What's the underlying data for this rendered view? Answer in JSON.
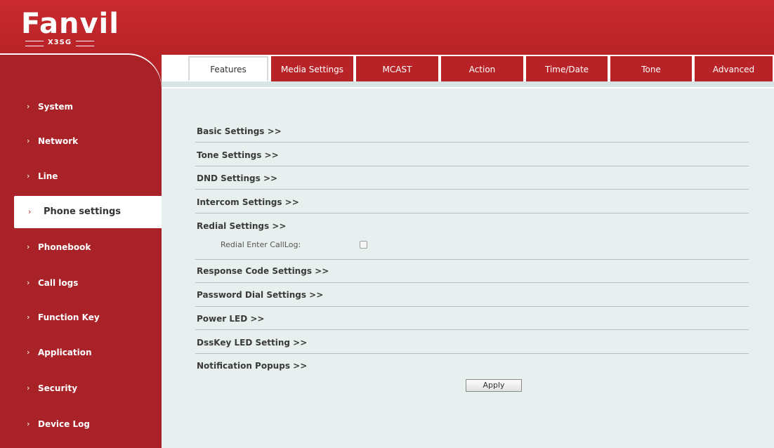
{
  "brand": {
    "logo_text": "Fanvil",
    "model": "X3SG"
  },
  "tabs": [
    {
      "label": "Features",
      "active": true
    },
    {
      "label": "Media Settings",
      "active": false
    },
    {
      "label": "MCAST",
      "active": false
    },
    {
      "label": "Action",
      "active": false
    },
    {
      "label": "Time/Date",
      "active": false
    },
    {
      "label": "Tone",
      "active": false
    },
    {
      "label": "Advanced",
      "active": false
    }
  ],
  "sidebar": {
    "items": [
      {
        "label": "System"
      },
      {
        "label": "Network"
      },
      {
        "label": "Line"
      },
      {
        "label": "Phone settings",
        "active": true
      },
      {
        "label": "Phonebook"
      },
      {
        "label": "Call logs"
      },
      {
        "label": "Function Key"
      },
      {
        "label": "Application"
      },
      {
        "label": "Security"
      },
      {
        "label": "Device Log"
      }
    ],
    "chevron": "›"
  },
  "sections": [
    "Basic Settings >>",
    "Tone Settings >>",
    "DND Settings >>",
    "Intercom Settings >>",
    "Redial Settings >>",
    "Response Code Settings >>",
    "Password Dial Settings >>",
    "Power LED >>",
    "DssKey LED Setting >>",
    "Notification Popups >>"
  ],
  "redial": {
    "enter_calllog_label": "Redial Enter CallLog:",
    "enter_calllog_checked": false
  },
  "apply_label": "Apply",
  "colors": {
    "brand_red": "#b82328",
    "panel_bg": "#e8f0ef"
  }
}
